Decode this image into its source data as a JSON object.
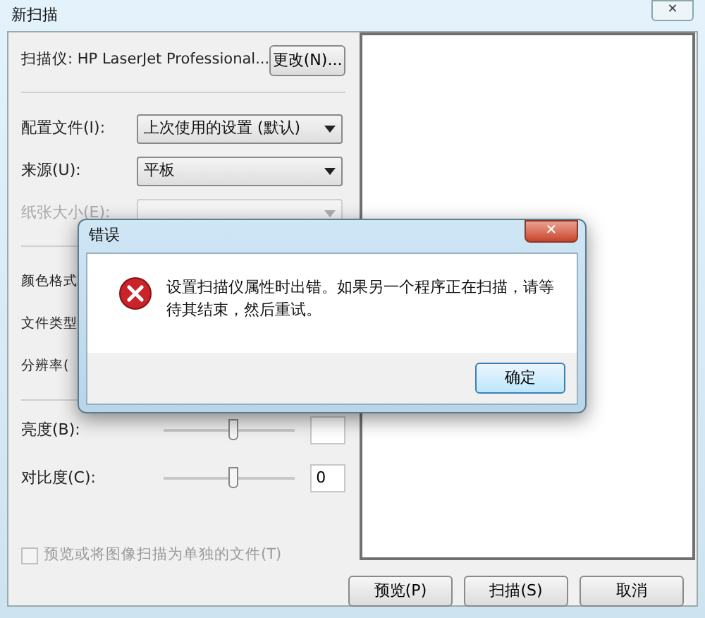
{
  "window": {
    "title": "新扫描",
    "close": "✕"
  },
  "scanner": {
    "label": "扫描仪: HP LaserJet Professional...",
    "button": "更改(N)..."
  },
  "fields": [
    {
      "label": "配置文件(I):",
      "value": "上次使用的设置 (默认)",
      "disabled": false
    },
    {
      "label": "来源(U):",
      "value": "平板",
      "disabled": false
    },
    {
      "label": "纸张大小(E):",
      "disabled": true
    }
  ],
  "hidden_labels": [
    "颜色格式",
    "文件类型",
    "分辨率("
  ],
  "sliders": [
    {
      "label": "亮度(B):",
      "level": 0.5
    },
    {
      "label": "对比度(C):",
      "level": 0.5,
      "value": "0"
    }
  ],
  "checkbox": {
    "label": "预览或将图像扫描为单独的文件(T)",
    "checked": false,
    "disabled": true
  },
  "buttons": [
    "预览(P)",
    "扫描(S)",
    "取消"
  ],
  "dialog": {
    "title": "错误",
    "close": "✕",
    "message": "设置扫描仪属性时出错。如果另一个程序正在扫描，请等待其结束，然后重试。",
    "button": "确定"
  }
}
